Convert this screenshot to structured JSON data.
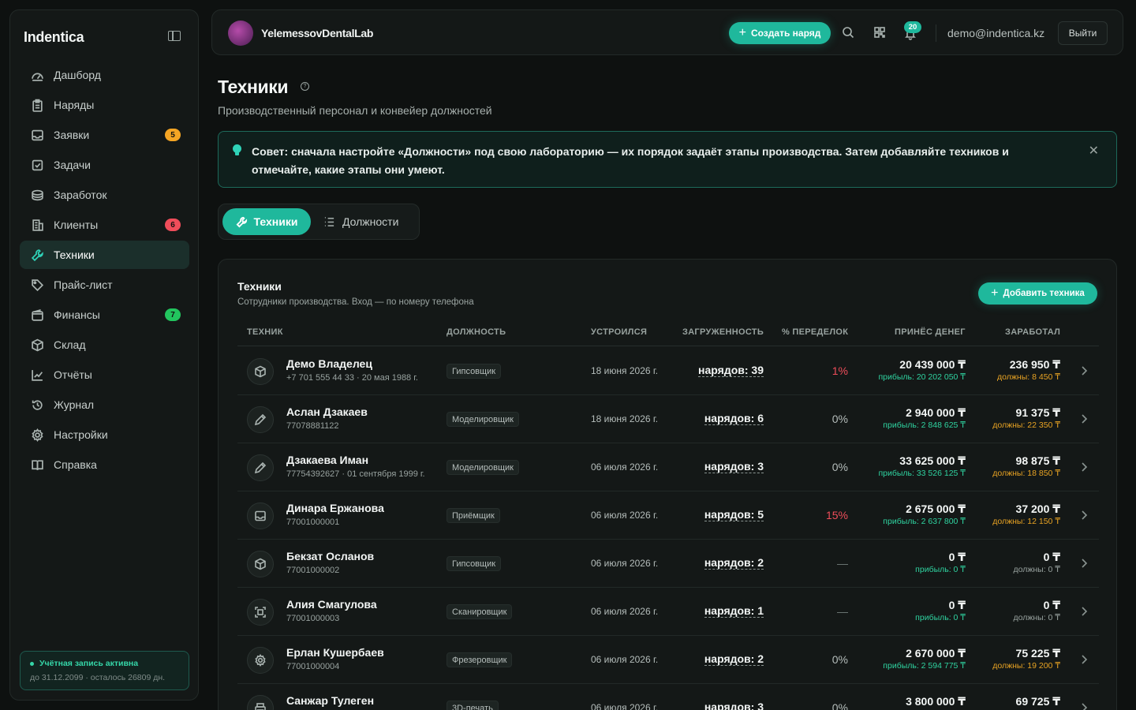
{
  "sidebar": {
    "brand": "Indentica",
    "items": [
      {
        "label": "Дашборд",
        "icon": "dashboard-icon"
      },
      {
        "label": "Наряды",
        "icon": "clipboard-icon"
      },
      {
        "label": "Заявки",
        "icon": "inbox-icon",
        "badge": "5",
        "badge_color": "#f5a524"
      },
      {
        "label": "Задачи",
        "icon": "checkbox-icon"
      },
      {
        "label": "Заработок",
        "icon": "coins-icon"
      },
      {
        "label": "Клиенты",
        "icon": "building-icon",
        "badge": "6",
        "badge_color": "#ef4d5a"
      },
      {
        "label": "Техники",
        "icon": "wrench-icon",
        "active": true
      },
      {
        "label": "Прайс-лист",
        "icon": "tag-icon"
      },
      {
        "label": "Финансы",
        "icon": "wallet-icon",
        "badge": "7",
        "badge_color": "#22c55e"
      },
      {
        "label": "Склад",
        "icon": "box-icon"
      },
      {
        "label": "Отчёты",
        "icon": "chart-icon"
      },
      {
        "label": "Журнал",
        "icon": "history-icon"
      },
      {
        "label": "Настройки",
        "icon": "gear-icon"
      },
      {
        "label": "Справка",
        "icon": "book-icon"
      }
    ],
    "account": {
      "status": "Учётная запись активна",
      "expiry": "до 31.12.2099 · осталось 26809 дн."
    }
  },
  "topbar": {
    "org_name": "YelemessovDentalLab",
    "create_label": "Создать наряд",
    "notif_count": "20",
    "email": "demo@indentica.kz",
    "logout_label": "Выйти"
  },
  "page": {
    "title": "Техники",
    "subtitle": "Производственный персонал и конвейер должностей",
    "tip": "Совет: сначала настройте «Должности» под свою лабораторию — их порядок задаёт этапы производства. Затем добавляйте техников и отмечайте, какие этапы они умеют.",
    "tabs": {
      "active": "Техники",
      "inactive": "Должности"
    }
  },
  "table": {
    "title": "Техники",
    "subtitle": "Сотрудники производства. Вход — по номеру телефона",
    "add_label": "Добавить техника",
    "headers": [
      "ТЕХНИК",
      "ДОЛЖНОСТЬ",
      "УСТРОИЛСЯ",
      "ЗАГРУЖЕННОСТЬ",
      "% ПЕРЕДЕЛОК",
      "ПРИНЁС ДЕНЕГ",
      "ЗАРАБОТАЛ"
    ],
    "rows": [
      {
        "icon": "cube-icon",
        "name": "Демо Владелец",
        "phone": "+7 701 555 44 33 · 20 мая 1988 г.",
        "role": "Гипсовщик",
        "date": "18 июня 2026 г.",
        "load": "нарядов: 39",
        "redo": "1%",
        "redo_state": "bad",
        "money": "20 439 000 ₸",
        "profit": "прибыль: 20 202 050 ₸",
        "earned": "236 950 ₸",
        "owed": "должны: 8 450 ₸"
      },
      {
        "icon": "pen-icon",
        "name": "Аслан Дзакаев",
        "phone": "77078881122",
        "role": "Моделировщик",
        "date": "18 июня 2026 г.",
        "load": "нарядов: 6",
        "redo": "0%",
        "redo_state": "ok",
        "money": "2 940 000 ₸",
        "profit": "прибыль: 2 848 625 ₸",
        "earned": "91 375 ₸",
        "owed": "должны: 22 350 ₸"
      },
      {
        "icon": "pen-icon",
        "name": "Дзакаева Иман",
        "phone": "77754392627 · 01 сентября 1999 г.",
        "role": "Моделировщик",
        "date": "06 июля 2026 г.",
        "load": "нарядов: 3",
        "redo": "0%",
        "redo_state": "ok",
        "money": "33 625 000 ₸",
        "profit": "прибыль: 33 526 125 ₸",
        "earned": "98 875 ₸",
        "owed": "должны: 18 850 ₸"
      },
      {
        "icon": "inbox-icon",
        "name": "Динара Ержанова",
        "phone": "77001000001",
        "role": "Приёмщик",
        "date": "06 июля 2026 г.",
        "load": "нарядов: 5",
        "redo": "15%",
        "redo_state": "bad",
        "money": "2 675 000 ₸",
        "profit": "прибыль: 2 637 800 ₸",
        "earned": "37 200 ₸",
        "owed": "должны: 12 150 ₸"
      },
      {
        "icon": "cube-icon",
        "name": "Бекзат Осланов",
        "phone": "77001000002",
        "role": "Гипсовщик",
        "date": "06 июля 2026 г.",
        "load": "нарядов: 2",
        "redo": "—",
        "redo_state": "dash",
        "money": "0 ₸",
        "profit": "прибыль: 0 ₸",
        "earned": "0 ₸",
        "owed": "должны: 0 ₸",
        "owed_zero": true
      },
      {
        "icon": "scan-icon",
        "name": "Алия Смагулова",
        "phone": "77001000003",
        "role": "Сканировщик",
        "date": "06 июля 2026 г.",
        "load": "нарядов: 1",
        "redo": "—",
        "redo_state": "dash",
        "money": "0 ₸",
        "profit": "прибыль: 0 ₸",
        "earned": "0 ₸",
        "owed": "должны: 0 ₸",
        "owed_zero": true
      },
      {
        "icon": "gear-icon",
        "name": "Ерлан Кушербаев",
        "phone": "77001000004",
        "role": "Фрезеровщик",
        "date": "06 июля 2026 г.",
        "load": "нарядов: 2",
        "redo": "0%",
        "redo_state": "ok",
        "money": "2 670 000 ₸",
        "profit": "прибыль: 2 594 775 ₸",
        "earned": "75 225 ₸",
        "owed": "должны: 19 200 ₸"
      },
      {
        "icon": "printer-icon",
        "name": "Санжар Тулеген",
        "phone": "",
        "role": "3D-печать",
        "date": "06 июля 2026 г.",
        "load": "нарядов: 3",
        "redo": "0%",
        "redo_state": "ok",
        "money": "3 800 000 ₸",
        "profit": "",
        "earned": "69 725 ₸",
        "owed": ""
      }
    ]
  }
}
